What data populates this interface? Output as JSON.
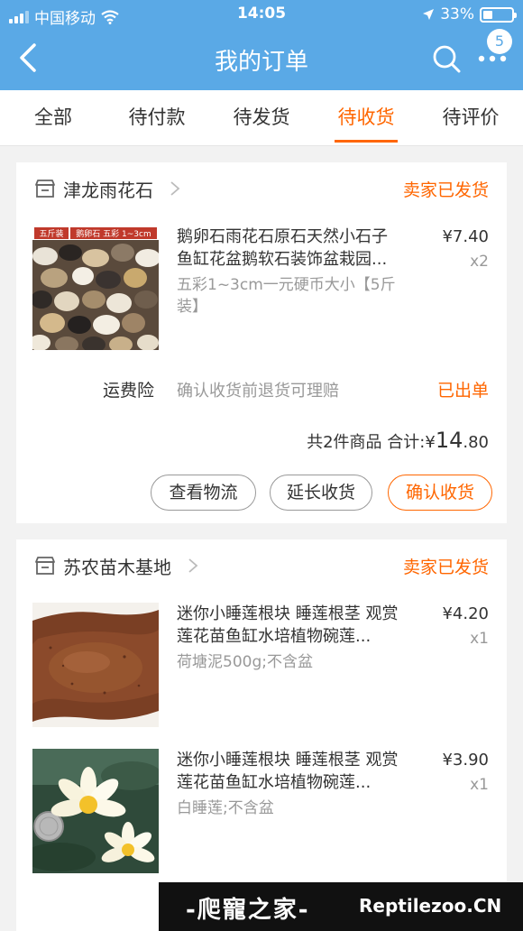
{
  "status_bar": {
    "carrier": "中国移动",
    "time": "14:05",
    "battery": "33%",
    "battery_level": 0.33
  },
  "nav": {
    "title": "我的订单",
    "badge": "5"
  },
  "tabs": [
    {
      "label": "全部"
    },
    {
      "label": "待付款"
    },
    {
      "label": "待发货"
    },
    {
      "label": "待收货"
    },
    {
      "label": "待评价"
    }
  ],
  "active_tab": "待收货",
  "orders": [
    {
      "shop": "津龙雨花石",
      "status": "卖家已发货",
      "items": [
        {
          "title": "鹅卵石雨花石原石天然小石子鱼缸花盆鹅软石装饰盆栽园...",
          "spec": "五彩1~3cm一元硬币大小【5斤装】",
          "price": "¥7.40",
          "qty": "x2",
          "thumb_tags": [
            "五斤装",
            "鹅卵石 五彩 1~3cm"
          ]
        }
      ],
      "insurance": {
        "label": "运费险",
        "desc": "确认收货前退货可理赔",
        "status": "已出单"
      },
      "summary": {
        "count_text": "共2件商品 合计:",
        "currency": "¥",
        "int_part": "14",
        "dec_part": ".80"
      },
      "buttons": [
        "查看物流",
        "延长收货",
        "确认收货"
      ]
    },
    {
      "shop": "苏农苗木基地",
      "status": "卖家已发货",
      "items": [
        {
          "title": "迷你小睡莲根块 睡莲根茎 观赏莲花苗鱼缸水培植物碗莲...",
          "spec": "荷塘泥500g;不含盆",
          "price": "¥4.20",
          "qty": "x1"
        },
        {
          "title": "迷你小睡莲根块 睡莲根茎 观赏莲花苗鱼缸水培植物碗莲...",
          "spec": "白睡莲;不含盆",
          "price": "¥3.90",
          "qty": "x1"
        }
      ]
    }
  ],
  "watermark": {
    "cn": "-爬寵之家-",
    "en": "Reptilezoo.CN"
  },
  "colors": {
    "header": "#5aa9e6",
    "accent": "#f60",
    "background": "#f2f2f2"
  }
}
